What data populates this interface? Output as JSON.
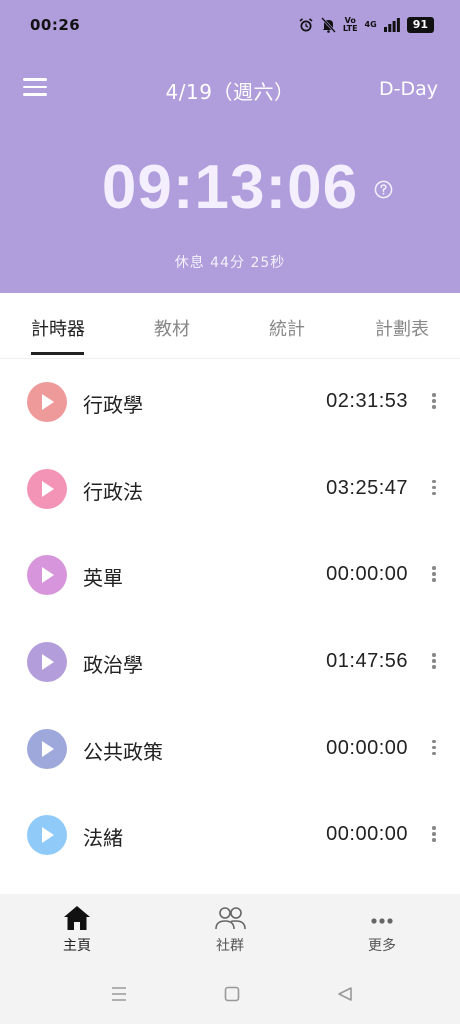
{
  "status_bar": {
    "time": "00:26",
    "volte": "Vo\nLTE",
    "network": "4G",
    "battery": "91"
  },
  "header": {
    "date": "4/19（週六）",
    "dday_label": "D-Day",
    "clock": "09:13:06",
    "rest_text": "休息  44分 25秒",
    "bg_color": "#b09ddc"
  },
  "tabs": [
    {
      "label": "計時器",
      "active": true
    },
    {
      "label": "教材",
      "active": false
    },
    {
      "label": "統計",
      "active": false
    },
    {
      "label": "計劃表",
      "active": false
    }
  ],
  "subjects": [
    {
      "name": "行政學",
      "time": "02:31:53",
      "color": "#ee9a9a"
    },
    {
      "name": "行政法",
      "time": "03:25:47",
      "color": "#f393b5"
    },
    {
      "name": "英單",
      "time": "00:00:00",
      "color": "#d796dc"
    },
    {
      "name": "政治學",
      "time": "01:47:56",
      "color": "#b39ddb"
    },
    {
      "name": "公共政策",
      "time": "00:00:00",
      "color": "#9fa8da"
    },
    {
      "name": "法緒",
      "time": "00:00:00",
      "color": "#90caf9"
    }
  ],
  "bottom_nav": [
    {
      "label": "主頁",
      "icon": "home-icon",
      "active": true
    },
    {
      "label": "社群",
      "icon": "people-icon",
      "active": false
    },
    {
      "label": "更多",
      "icon": "more-horizontal-icon",
      "active": false
    }
  ]
}
